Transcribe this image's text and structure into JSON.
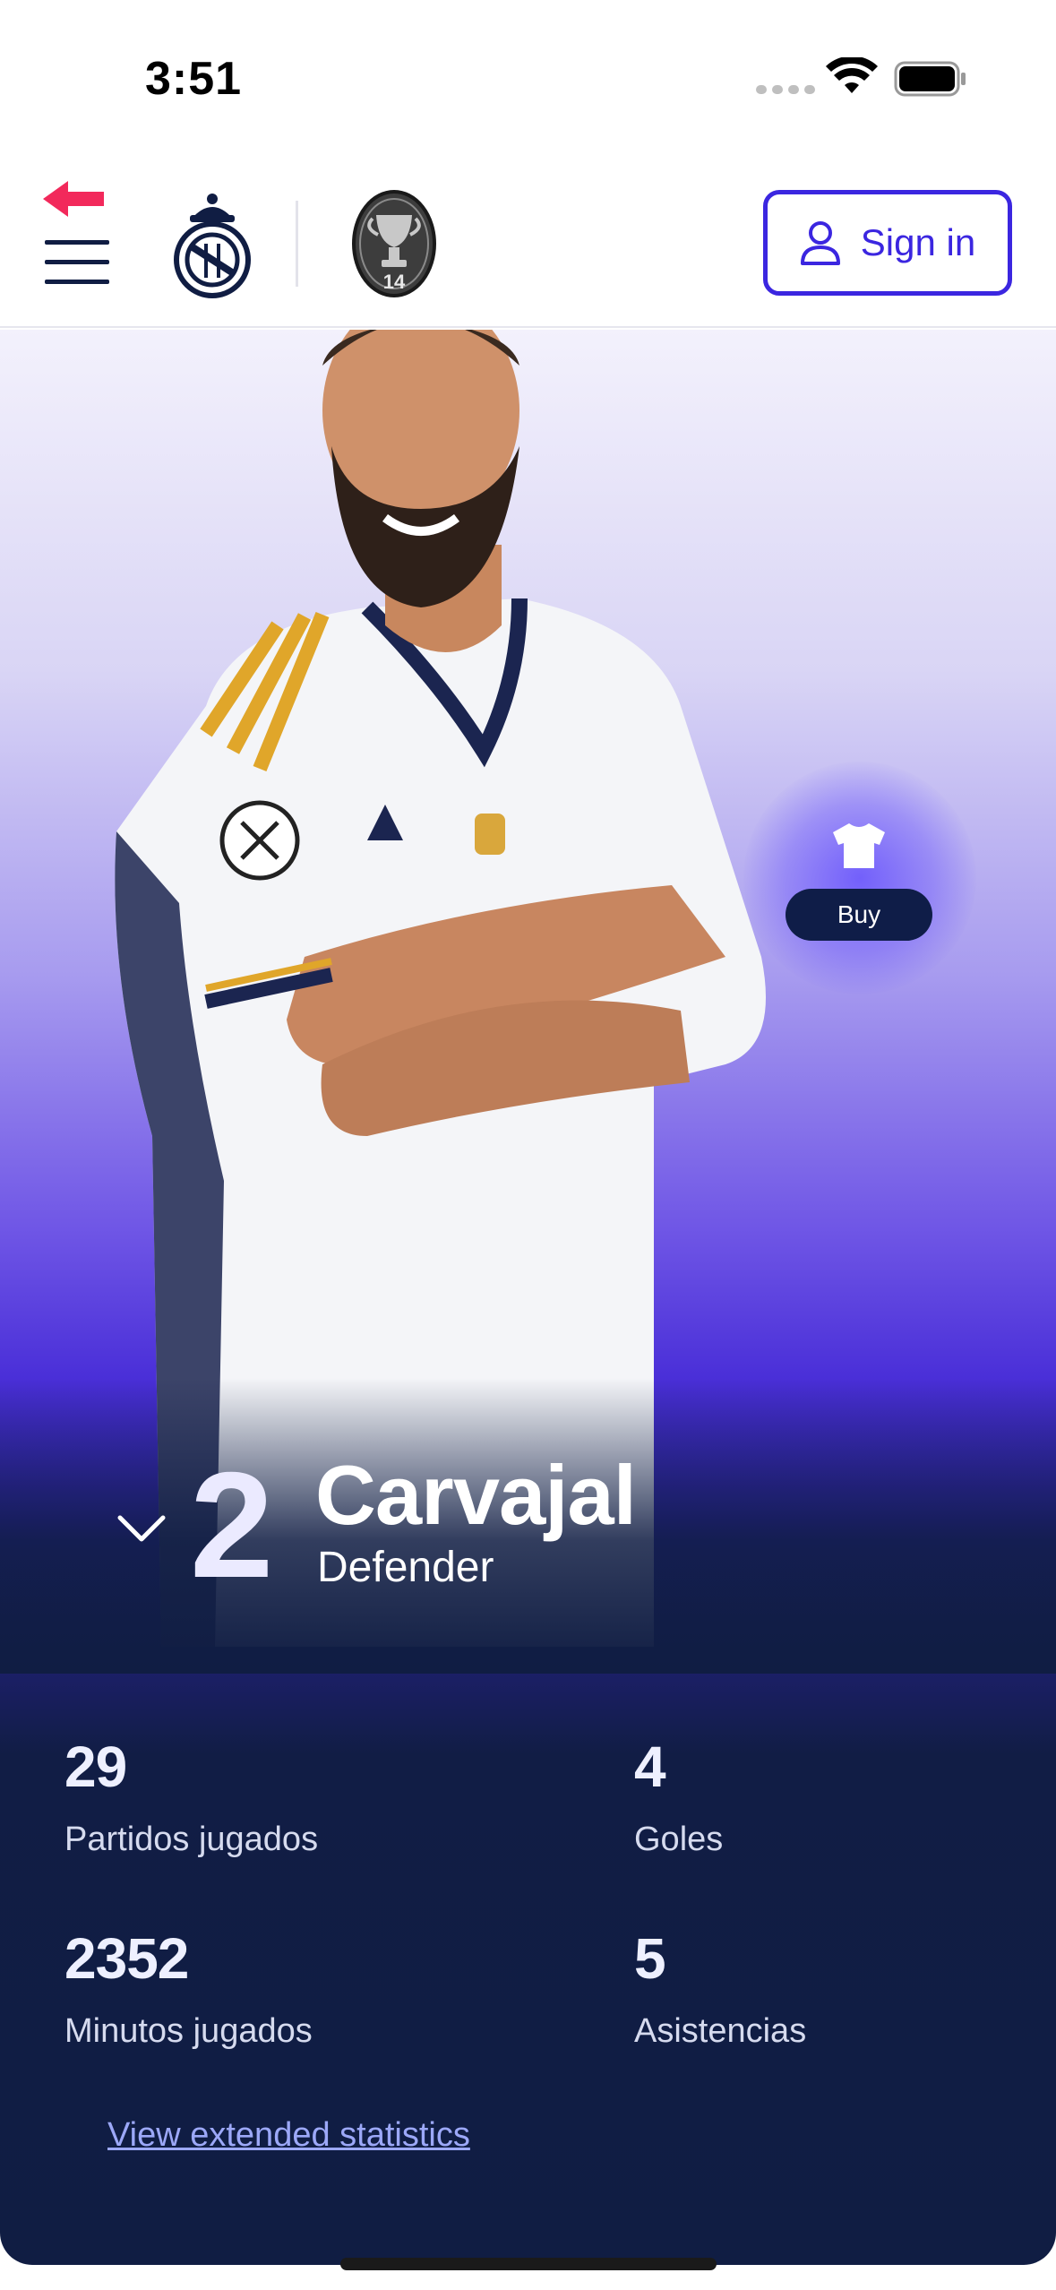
{
  "status_bar": {
    "time": "3:51",
    "icons": [
      "signal-dots-icon",
      "wifi-icon",
      "battery-icon"
    ]
  },
  "header": {
    "icons": [
      "back-arrow-icon",
      "hamburger-menu-icon",
      "club-crest-icon",
      "champions-league-14-badge"
    ],
    "ucl_badge_text": "14",
    "sign_in_label": "Sign in",
    "accent_color": "#3b26e0",
    "arrow_color": "#f2295b"
  },
  "hero": {
    "buy_label": "Buy",
    "buy_icon": "shirt-icon",
    "player": {
      "number": "2",
      "name": "Carvajal",
      "position": "Defender"
    }
  },
  "stats": [
    {
      "value": "29",
      "label": "Partidos jugados"
    },
    {
      "value": "4",
      "label": "Goles"
    },
    {
      "value": "2352",
      "label": "Minutos jugados"
    },
    {
      "value": "5",
      "label": "Asistencias"
    }
  ],
  "extended_link_label": "View extended statistics",
  "colors": {
    "navy": "#101d43",
    "purple": "#4a2fd8",
    "link": "#9ca8f8"
  }
}
